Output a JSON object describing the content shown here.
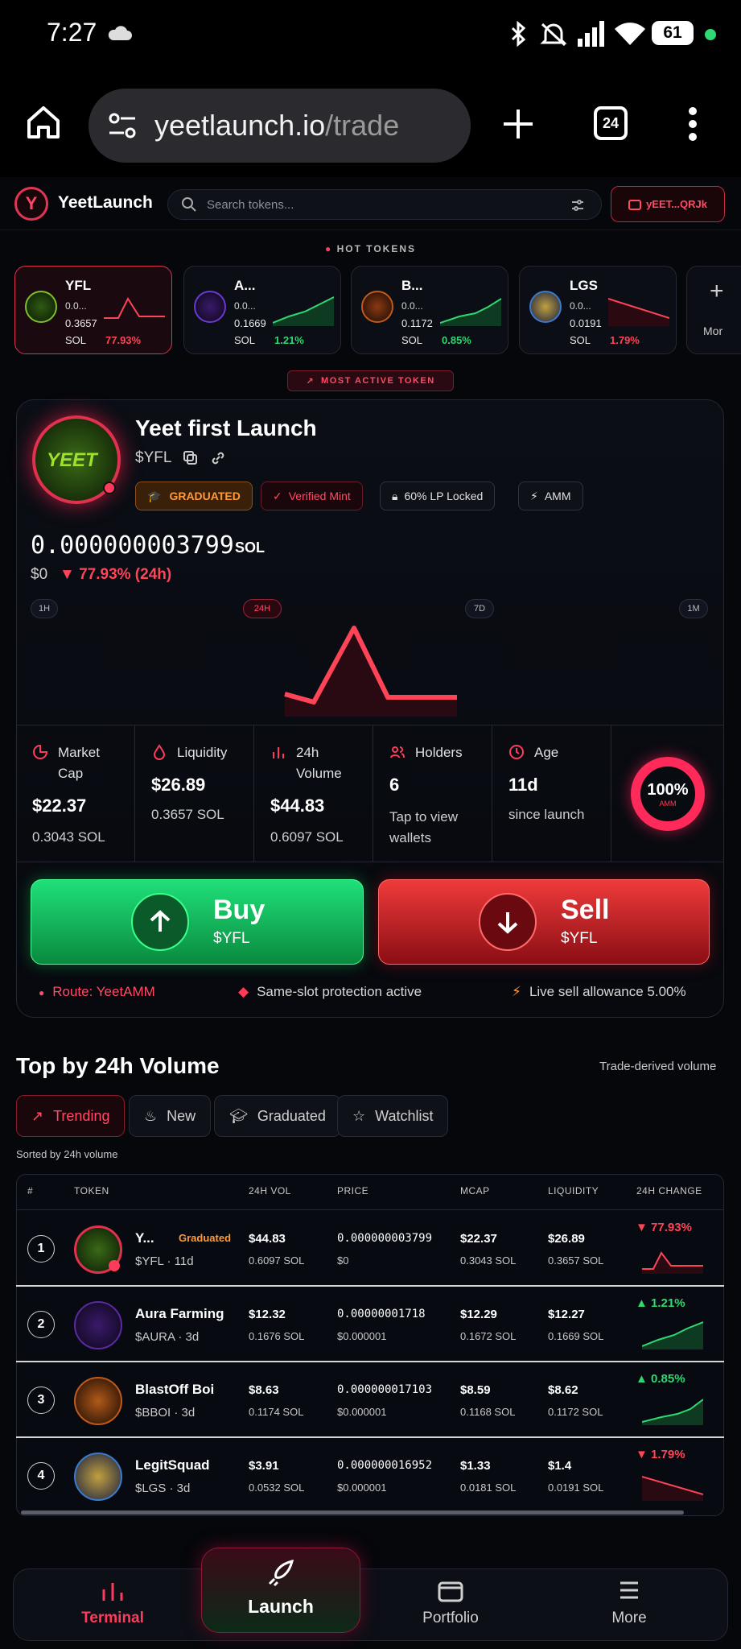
{
  "status": {
    "time": "7:27",
    "battery": "61"
  },
  "browser": {
    "url_host": "yeetlaunch.io",
    "url_path": "/trade",
    "tab_count": "24"
  },
  "header": {
    "brand": "YeetLaunch",
    "logo_letter": "Y",
    "search_placeholder": "Search tokens...",
    "wallet": "yEET...QRJk"
  },
  "hot": {
    "title": "HOT TOKENS",
    "cards": [
      {
        "symbol": "YFL",
        "short": "0.0...",
        "price": "0.3657",
        "unit": "SOL",
        "change": "77.93%",
        "dir": "down"
      },
      {
        "symbol": "A...",
        "short": "0.0...",
        "price": "0.1669",
        "unit": "SOL",
        "change": "1.21%",
        "dir": "up"
      },
      {
        "symbol": "B...",
        "short": "0.0...",
        "price": "0.1172",
        "unit": "SOL",
        "change": "0.85%",
        "dir": "up"
      },
      {
        "symbol": "LGS",
        "short": "0.0...",
        "price": "0.0191",
        "unit": "SOL",
        "change": "1.79%",
        "dir": "down"
      }
    ],
    "more": "Mor"
  },
  "featured": {
    "badge": "MOST ACTIVE TOKEN",
    "name": "Yeet first Launch",
    "ticker": "$YFL",
    "tags": [
      "GRADUATED",
      "Verified Mint",
      "60% LP Locked",
      "AMM"
    ],
    "price": "0.000000003799",
    "price_unit": "SOL",
    "usd": "$0",
    "change": "▼ 77.93% (24h)",
    "timeframes": [
      "1H",
      "24H",
      "7D",
      "1M"
    ],
    "stats": [
      {
        "label": "Market\nCap",
        "value": "$22.37",
        "sub": "0.3043 SOL"
      },
      {
        "label": "Liquidity",
        "value": "$26.89",
        "sub": "0.3657 SOL"
      },
      {
        "label": "24h\nVolume",
        "value": "$44.83",
        "sub": "0.6097 SOL"
      },
      {
        "label": "Holders",
        "value": "6",
        "sub": "Tap to view\nwallets"
      },
      {
        "label": "Age",
        "value": "11d",
        "sub": "since launch"
      }
    ],
    "amm_pct": "100%",
    "amm_label": "AMM",
    "buy": {
      "label": "Buy",
      "sub": "$YFL"
    },
    "sell": {
      "label": "Sell",
      "sub": "$YFL"
    },
    "route": "Route: YeetAMM",
    "protection": "Same-slot protection active",
    "allowance": "Live sell allowance 5.00%"
  },
  "volume": {
    "title": "Top by 24h Volume",
    "note": "Trade-derived volume",
    "tabs": [
      "Trending",
      "New",
      "Graduated",
      "Watchlist"
    ],
    "sorted": "Sorted by 24h volume",
    "headers": [
      "#",
      "TOKEN",
      "24H VOL",
      "PRICE",
      "MCAP",
      "LIQUIDITY",
      "24H CHANGE"
    ],
    "rows": [
      {
        "rank": "1",
        "name": "Y...",
        "tag": "Graduated",
        "sub": "$YFL · 11d",
        "vol": "$44.83",
        "vol_sol": "0.6097 SOL",
        "price": "0.000000003799",
        "price_usd": "$0",
        "mcap": "$22.37",
        "mcap_sol": "0.3043 SOL",
        "liq": "$26.89",
        "liq_sol": "0.3657 SOL",
        "change": "▼ 77.93%"
      },
      {
        "rank": "2",
        "name": "Aura Farming",
        "tag": "",
        "sub": "$AURA · 3d",
        "vol": "$12.32",
        "vol_sol": "0.1676 SOL",
        "price": "0.00000001718",
        "price_usd": "$0.000001",
        "mcap": "$12.29",
        "mcap_sol": "0.1672 SOL",
        "liq": "$12.27",
        "liq_sol": "0.1669 SOL",
        "change": "▲ 1.21%"
      },
      {
        "rank": "3",
        "name": "BlastOff Boi",
        "tag": "",
        "sub": "$BBOI · 3d",
        "vol": "$8.63",
        "vol_sol": "0.1174 SOL",
        "price": "0.000000017103",
        "price_usd": "$0.000001",
        "mcap": "$8.59",
        "mcap_sol": "0.1168 SOL",
        "liq": "$8.62",
        "liq_sol": "0.1172 SOL",
        "change": "▲ 0.85%"
      },
      {
        "rank": "4",
        "name": "LegitSquad",
        "tag": "",
        "sub": "$LGS · 3d",
        "vol": "$3.91",
        "vol_sol": "0.0532 SOL",
        "price": "0.000000016952",
        "price_usd": "$0.000001",
        "mcap": "$1.33",
        "mcap_sol": "0.0181 SOL",
        "liq": "$1.4",
        "liq_sol": "0.0191 SOL",
        "change": "▼ 1.79%"
      }
    ]
  },
  "nav": {
    "items": [
      "Terminal",
      "Launch",
      "Portfolio",
      "More"
    ]
  },
  "colors": {
    "accent": "#ff3b5c",
    "green": "#2fd872",
    "red": "#ff4458",
    "bg": "#05070b"
  }
}
